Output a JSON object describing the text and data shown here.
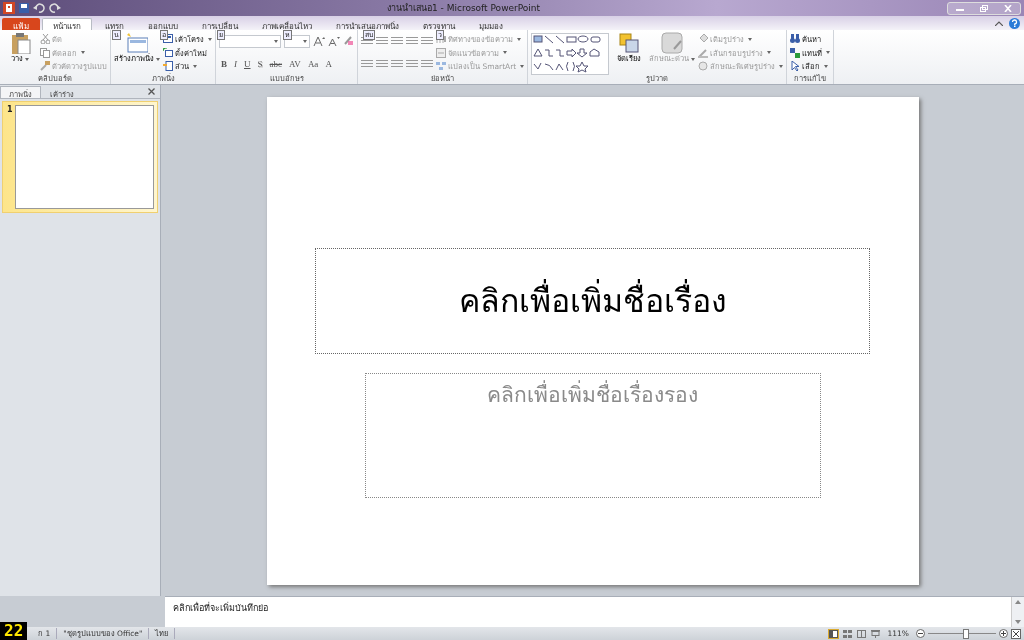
{
  "window": {
    "title": "งานนำเสนอ1 - Microsoft PowerPoint"
  },
  "ribbon_tabs": [
    {
      "label": "แฟ้ม",
      "kind": "file",
      "selected": false
    },
    {
      "label": "หน้าแรก",
      "kind": "tab",
      "selected": true
    },
    {
      "label": "แทรก",
      "kind": "tab",
      "selected": false,
      "key_tip": "น"
    },
    {
      "label": "ออกแบบ",
      "kind": "tab",
      "selected": false,
      "key_tip": "อ"
    },
    {
      "label": "การเปลี่ยน",
      "kind": "tab",
      "selected": false,
      "key_tip": "ย"
    },
    {
      "label": "ภาพเคลื่อนไหว",
      "kind": "tab",
      "selected": false,
      "key_tip": "ห"
    },
    {
      "label": "การนำเสนอภาพนิ่ง",
      "kind": "tab",
      "selected": false,
      "key_tip": "สบ"
    },
    {
      "label": "ตรวจทาน",
      "kind": "tab",
      "selected": false,
      "key_tip": "ว"
    },
    {
      "label": "มุมมอง",
      "kind": "tab",
      "selected": false
    }
  ],
  "ribbon_groups": [
    {
      "kind": "clipboard",
      "label": "คลิปบอร์ด",
      "large": [
        {
          "label": "วาง",
          "dropdown": true,
          "disabled": false
        }
      ],
      "commands": [
        {
          "label": "ตัด",
          "dropdown": false,
          "disabled": true
        },
        {
          "label": "คัดลอก",
          "dropdown": true,
          "disabled": true
        },
        {
          "label": "ตัวคัดวางรูปแบบ",
          "dropdown": false,
          "disabled": true
        }
      ]
    },
    {
      "kind": "slides",
      "label": "ภาพนิ่ง",
      "large": [
        {
          "label": "สร้างภาพนิ่ง",
          "dropdown": true,
          "disabled": false
        }
      ],
      "commands": [
        {
          "label": "เค้าโครง",
          "dropdown": true,
          "disabled": false
        },
        {
          "label": "ตั้งค่าใหม่",
          "dropdown": false,
          "disabled": false
        },
        {
          "label": "ส่วน",
          "dropdown": true,
          "disabled": false
        }
      ]
    },
    {
      "kind": "font",
      "label": "แบบอักษร",
      "font_buttons": [
        "B",
        "I",
        "U",
        "S",
        "abc",
        "AV",
        "Aa",
        "A"
      ]
    },
    {
      "kind": "paragraph",
      "label": "ย่อหน้า",
      "commands": [
        {
          "label": "ทิศทางของข้อความ",
          "dropdown": true,
          "disabled": true
        },
        {
          "label": "จัดแนวข้อความ",
          "dropdown": true,
          "disabled": true
        },
        {
          "label": "แปลงเป็น SmartArt",
          "dropdown": true,
          "disabled": true
        }
      ]
    },
    {
      "kind": "drawing",
      "label": "รูปวาด",
      "large": [
        {
          "label": "จัดเรียง",
          "dropdown": false,
          "disabled": false
        },
        {
          "label": "ลักษณะด่วน",
          "dropdown": true,
          "disabled": true
        }
      ],
      "commands": [
        {
          "label": "เติมรูปร่าง",
          "dropdown": true,
          "disabled": true
        },
        {
          "label": "เส้นกรอบรูปร่าง",
          "dropdown": true,
          "disabled": true
        },
        {
          "label": "ลักษณะพิเศษรูปร่าง",
          "dropdown": true,
          "disabled": true
        }
      ]
    },
    {
      "kind": "editing",
      "label": "การแก้ไข",
      "commands": [
        {
          "label": "ค้นหา",
          "dropdown": false,
          "disabled": false
        },
        {
          "label": "แทนที่",
          "dropdown": true,
          "disabled": false
        },
        {
          "label": "เลือก",
          "dropdown": true,
          "disabled": false
        }
      ]
    }
  ],
  "slide_pane": {
    "tabs": [
      {
        "label": "ภาพนิ่ง",
        "selected": true
      },
      {
        "label": "เค้าร่าง",
        "selected": false
      }
    ],
    "slides": [
      {
        "number": "1",
        "selected": true
      }
    ]
  },
  "slide": {
    "title_placeholder": "คลิกเพื่อเพิ่มชื่อเรื่อง",
    "subtitle_placeholder": "คลิกเพื่อเพิ่มชื่อเรื่องรอง"
  },
  "notes": {
    "placeholder": "คลิกเพื่อที่จะเพิ่มบันทึกย่อ"
  },
  "step_badge": "22",
  "status_bar": {
    "items": [
      "ก 1",
      "\"ชุดรูปแบบของ Office\"",
      "ไทย"
    ],
    "views": [
      {
        "selected": true
      },
      {
        "selected": false
      },
      {
        "selected": false
      },
      {
        "selected": false
      }
    ],
    "zoom": {
      "reading": "111%",
      "level": 0.56
    }
  }
}
